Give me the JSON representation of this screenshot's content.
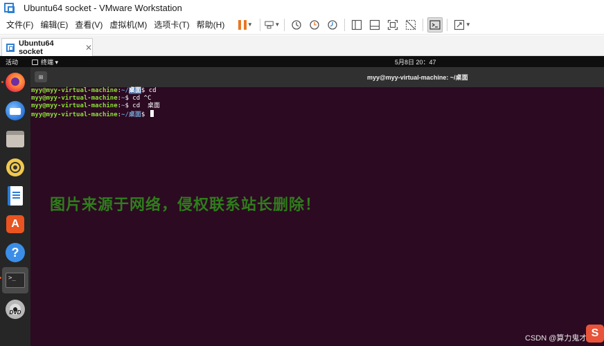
{
  "window": {
    "title": "Ubuntu64 socket - VMware Workstation"
  },
  "menu": [
    "文件(F)",
    "编辑(E)",
    "查看(V)",
    "虚拟机(M)",
    "选项卡(T)",
    "帮助(H)"
  ],
  "toolbar": {
    "buttons": [
      "pause-icon",
      "send-keys-icon",
      "snapshot-take-icon",
      "snapshot-revert-icon",
      "snapshot-manager-icon",
      "library-view-icon",
      "thumbnail-bar-icon",
      "full-screen-icon",
      "unity-icon",
      "console-view-icon",
      "stretch-icon"
    ],
    "accent_color": "#e87722"
  },
  "tabs": [
    {
      "label": "Ubuntu64 socket",
      "close": "✕"
    }
  ],
  "guest": {
    "topbar": {
      "activities": "活动",
      "app_menu": "终端 ▾",
      "clock": "5月8日  20：47"
    },
    "dock": {
      "apps": [
        "firefox-icon",
        "thunderbird-icon",
        "files-icon",
        "rhythmbox-icon",
        "libreoffice-writer-icon",
        "app-store-icon",
        "help-icon",
        "terminal-icon",
        "dvd-icon"
      ],
      "terminal_glyph": ">_",
      "help_glyph": "?",
      "store_glyph": "A",
      "dvd_label": "DVD"
    },
    "terminal": {
      "newtab_glyph": "⊞",
      "title": "myy@myy-virtual-machine: ~/桌面",
      "lines": [
        {
          "user": "myy@myy-virtual-machine",
          "sep": ":",
          "path": "~/",
          "sel": "桌面",
          "rest": "$ cd"
        },
        {
          "user": "myy@myy-virtual-machine",
          "sep": ":",
          "path": "~",
          "sel": "",
          "rest": "$ cd ^C"
        },
        {
          "user": "myy@myy-virtual-machine",
          "sep": ":",
          "path": "~",
          "sel": "",
          "rest": "$ cd  桌面"
        },
        {
          "user": "myy@myy-virtual-machine",
          "sep": ":",
          "path": "~/桌面",
          "sel": "",
          "rest": "$ "
        }
      ],
      "colors": {
        "bg": "#2c0a22",
        "user": "#8ae234",
        "path": "#729fcf"
      }
    }
  },
  "watermark": "图片来源于网络，侵权联系站长删除！",
  "credit": {
    "text": "CSDN @算力鬼才",
    "logo": "S"
  }
}
